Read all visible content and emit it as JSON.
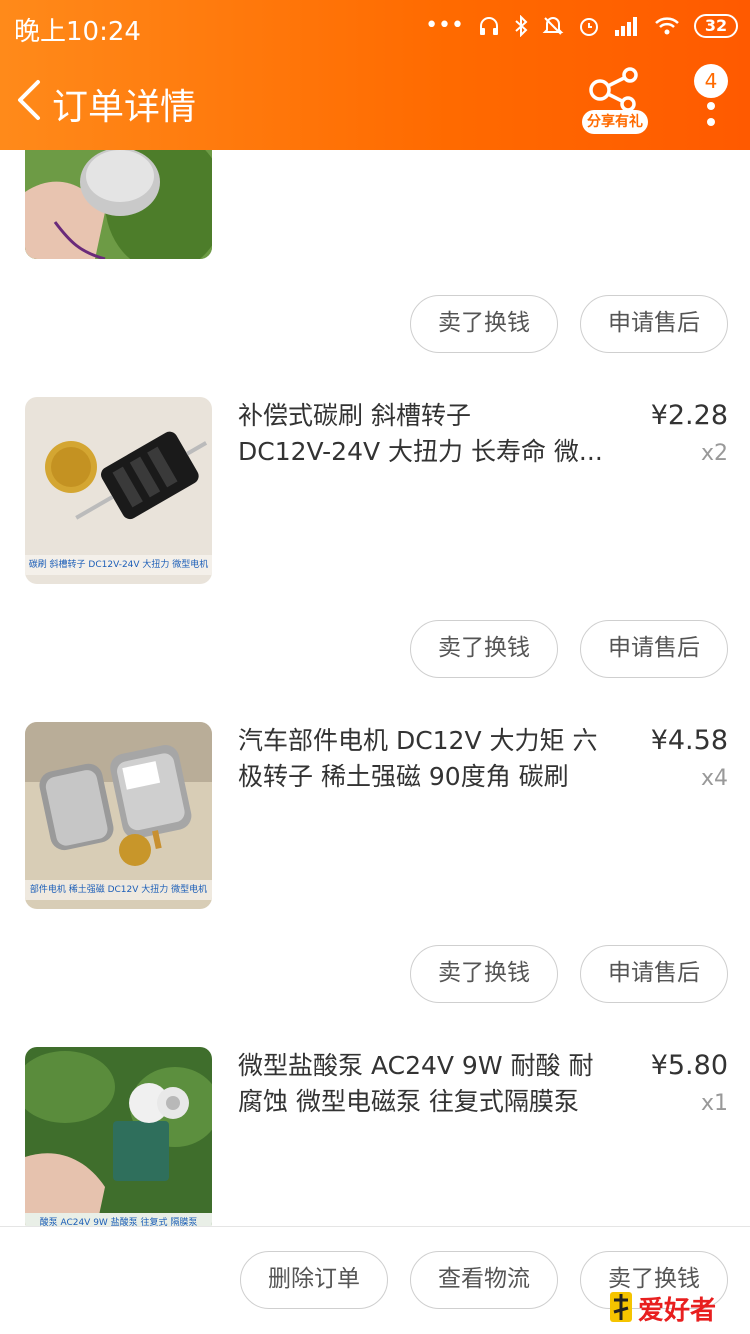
{
  "status_bar": {
    "time": "晚上10:24",
    "battery": "32",
    "icons": [
      "dots-icon",
      "headphones-icon",
      "bluetooth-icon",
      "mute-icon",
      "alarm-icon",
      "signal-icon",
      "wifi-icon",
      "battery-icon"
    ]
  },
  "nav": {
    "title": "订单详情",
    "share_label": "分享有礼",
    "badge_count": "4"
  },
  "items": [
    {
      "title_line1": "",
      "title_line2": "",
      "price": "",
      "qty": "",
      "buttons": [
        "卖了换钱",
        "申请售后"
      ]
    },
    {
      "title_line1": "补偿式碳刷 斜槽转子",
      "title_line2": "DC12V-24V 大扭力 长寿命 微...",
      "price": "¥2.28",
      "qty": "x2",
      "caption": "碳刷 斜槽转子 DC12V-24V 大扭力 微型电机",
      "buttons": [
        "卖了换钱",
        "申请售后"
      ]
    },
    {
      "title_line1": "汽车部件电机 DC12V 大力矩 六",
      "title_line2": "极转子 稀土强磁 90度角 碳刷",
      "price": "¥4.58",
      "qty": "x4",
      "caption": "部件电机 稀土强磁 DC12V 大扭力 微型电机",
      "buttons": [
        "卖了换钱",
        "申请售后"
      ]
    },
    {
      "title_line1": "微型盐酸泵 AC24V 9W 耐酸 耐",
      "title_line2": "腐蚀 微型电磁泵  往复式隔膜泵",
      "price": "¥5.80",
      "qty": "x1",
      "caption": "酸泵 AC24V 9W 盐酸泵 往复式 隔膜泵"
    }
  ],
  "footer": {
    "buttons": [
      "删除订单",
      "查看物流",
      "卖了换钱"
    ]
  },
  "watermark": "爱好者",
  "colors": {
    "header": "#ff6a00",
    "accent": "#ff5a00"
  }
}
